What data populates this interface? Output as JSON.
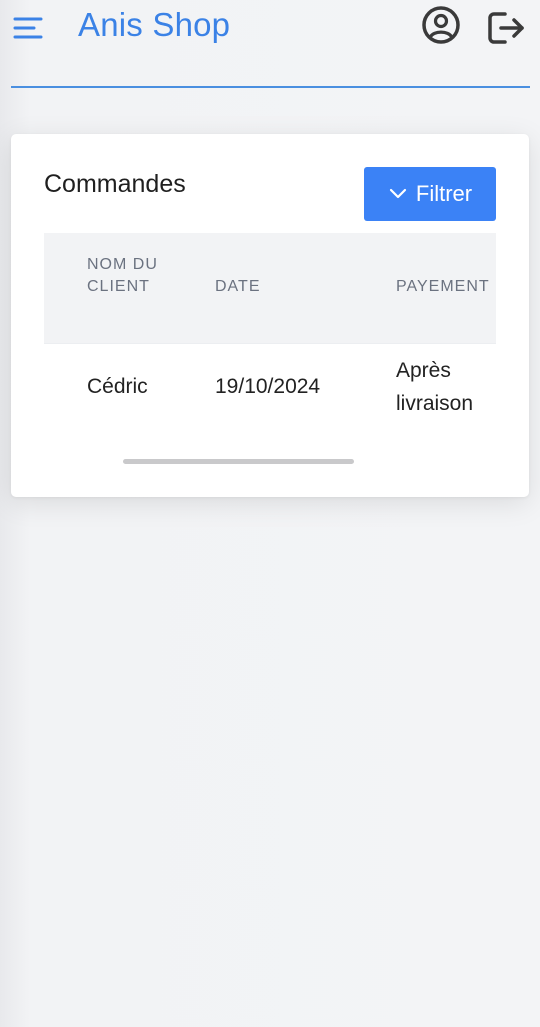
{
  "header": {
    "app_title": "Anis Shop",
    "icons": {
      "menu": "menu-icon",
      "profile": "user-circle-icon",
      "logout": "logout-icon"
    },
    "accent_color": "#3b82e6"
  },
  "orders_card": {
    "title": "Commandes",
    "filter_button": {
      "label": "Filtrer",
      "icon": "chevron-down-icon",
      "color": "#3b82f6"
    },
    "table": {
      "columns": [
        {
          "key": "client",
          "label": "NOM DU CLIENT"
        },
        {
          "key": "date",
          "label": "DATE"
        },
        {
          "key": "payment",
          "label": "PAYEMENT"
        }
      ],
      "rows": [
        {
          "client": "Cédric",
          "date": "19/10/2024",
          "payment": "Après livraison"
        }
      ]
    }
  }
}
